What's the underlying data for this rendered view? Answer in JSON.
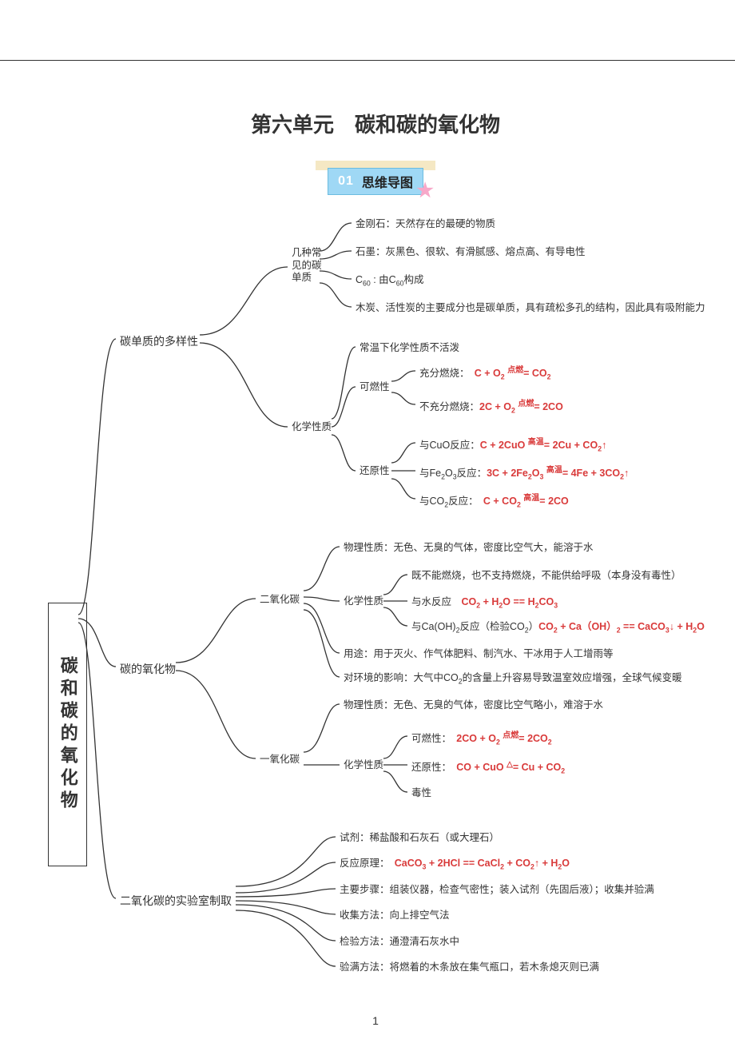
{
  "title": "第六单元　碳和碳的氧化物",
  "badge_num": "01",
  "badge_text": "思维导图",
  "root": "碳和碳的氧化物",
  "chart_data": {
    "type": "mindmap",
    "root": "碳和碳的氧化物",
    "children": [
      {
        "label": "碳单质的多样性",
        "children": [
          {
            "label": "几种常见的碳单质",
            "children": [
              {
                "text": "金刚石：天然存在的最硬的物质"
              },
              {
                "text": "石墨：灰黑色、很软、有滑腻感、熔点高、有导电性"
              },
              {
                "text": "C₆₀ : 由C₆₀构成"
              },
              {
                "text": "木炭、活性炭的主要成分也是碳单质，具有疏松多孔的结构，因此具有吸附能力"
              }
            ]
          },
          {
            "label": "化学性质",
            "children": [
              {
                "text": "常温下化学性质不活泼"
              },
              {
                "label": "可燃性",
                "children": [
                  {
                    "text": "充分燃烧：",
                    "equation": "C + O₂ =(点燃)= CO₂"
                  },
                  {
                    "text": "不充分燃烧：",
                    "equation": "2C + O₂ =(点燃)= 2CO"
                  }
                ]
              },
              {
                "label": "还原性",
                "children": [
                  {
                    "text": "与CuO反应：",
                    "equation": "C + 2CuO =(高温)= 2Cu + CO₂↑"
                  },
                  {
                    "text": "与Fe₂O₃反应：",
                    "equation": "3C + 2Fe₂O₃ =(高温)= 4Fe + 3CO₂↑"
                  },
                  {
                    "text": "与CO₂反应：",
                    "equation": "C + CO₂ =(高温)= 2CO"
                  }
                ]
              }
            ]
          }
        ]
      },
      {
        "label": "碳的氧化物",
        "children": [
          {
            "label": "二氧化碳",
            "children": [
              {
                "text": "物理性质：无色、无臭的气体，密度比空气大，能溶于水"
              },
              {
                "label": "化学性质",
                "children": [
                  {
                    "text": "既不能燃烧，也不支持燃烧，不能供给呼吸（本身没有毒性）"
                  },
                  {
                    "text": "与水反应",
                    "equation": "CO₂ + H₂O == H₂CO₃"
                  },
                  {
                    "text": "与Ca(OH)₂反应（检验CO₂）",
                    "equation": "CO₂ + Ca(OH)₂ == CaCO₃↓ + H₂O"
                  }
                ]
              },
              {
                "text": "用途：用于灭火、作气体肥料、制汽水、干冰用于人工增雨等"
              },
              {
                "text": "对环境的影响：大气中CO₂的含量上升容易导致温室效应增强，全球气候变暖"
              }
            ]
          },
          {
            "label": "一氧化碳",
            "children": [
              {
                "text": "物理性质：无色、无臭的气体，密度比空气略小，难溶于水"
              },
              {
                "label": "化学性质",
                "children": [
                  {
                    "text": "可燃性：",
                    "equation": "2CO + O₂ =(点燃)= 2CO₂"
                  },
                  {
                    "text": "还原性：",
                    "equation": "CO + CuO =(△)= Cu + CO₂"
                  },
                  {
                    "text": "毒性"
                  }
                ]
              }
            ]
          }
        ]
      },
      {
        "label": "二氧化碳的实验室制取",
        "children": [
          {
            "text": "试剂：稀盐酸和石灰石（或大理石）"
          },
          {
            "text": "反应原理：",
            "equation": "CaCO₃ + 2HCl == CaCl₂ + CO₂↑ + H₂O"
          },
          {
            "text": "主要步骤：组装仪器，检查气密性；装入试剂（先固后液）；收集并验满"
          },
          {
            "text": "收集方法：向上排空气法"
          },
          {
            "text": "检验方法：通澄清石灰水中"
          },
          {
            "text": "验满方法：将燃着的木条放在集气瓶口，若木条熄灭则已满"
          }
        ]
      }
    ]
  },
  "page_number": "1"
}
